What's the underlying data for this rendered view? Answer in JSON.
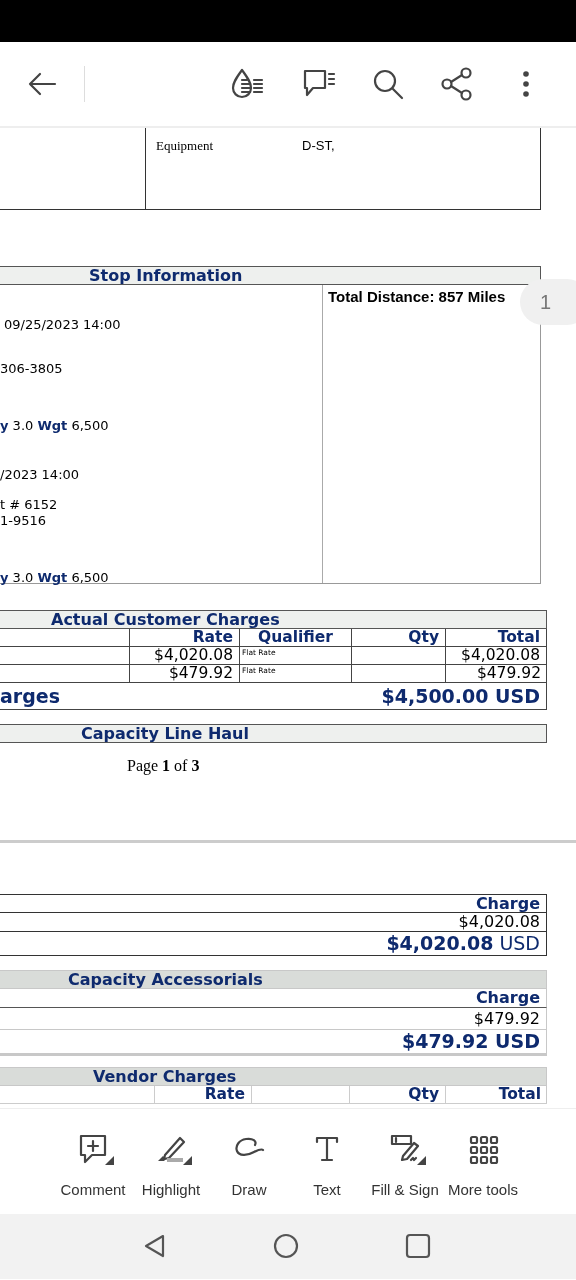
{
  "document": {
    "equipment": {
      "label": "Equipment",
      "value": "D-ST,"
    },
    "stop_information": {
      "title": "Stop Information",
      "total_distance": "Total Distance: 857 Miles",
      "lines": [
        "09/25/2023 14:00",
        "306-3805",
        "**y** 3.0 **Wgt** 6,500",
        "/2023 14:00",
        "t # 6152",
        "1-9516",
        "**y** 3.0 **Wgt** 6,500"
      ]
    },
    "customer_charges": {
      "title": "Actual Customer Charges",
      "columns": [
        "Rate",
        "Qualifier",
        "Qty",
        "Total"
      ],
      "rows": [
        {
          "rate": "$4,020.08",
          "qualifier": "Flat Rate",
          "total": "$4,020.08"
        },
        {
          "rate": "$479.92",
          "qualifier": "Flat Rate",
          "total": "$479.92"
        }
      ],
      "total_label": "arges",
      "total_value": "$4,500.00 USD"
    },
    "line_haul": {
      "title": "Capacity Line Haul"
    },
    "page_footer": "Page **1** of **3**",
    "line_haul_charges": {
      "column": "Charge",
      "value": "$4,020.08",
      "total": "**$4,020.08** USD"
    },
    "accessorials": {
      "title": "Capacity Accessorials",
      "column": "Charge",
      "value": "$479.92",
      "total": "$479.92 USD"
    },
    "vendor_charges": {
      "title": "Vendor Charges",
      "columns": [
        "Rate",
        "Qty",
        "Total"
      ]
    }
  },
  "page_badge": "1",
  "tools": [
    {
      "kind": "comment",
      "label": "Comment",
      "has_menu": true
    },
    {
      "kind": "highlight",
      "label": "Highlight",
      "has_menu": true
    },
    {
      "kind": "draw",
      "label": "Draw",
      "has_menu": false
    },
    {
      "kind": "text",
      "label": "Text",
      "has_menu": false
    },
    {
      "kind": "fill-sign",
      "label": "Fill & Sign",
      "has_menu": true
    },
    {
      "kind": "more",
      "label": "More tools",
      "has_menu": false
    }
  ]
}
